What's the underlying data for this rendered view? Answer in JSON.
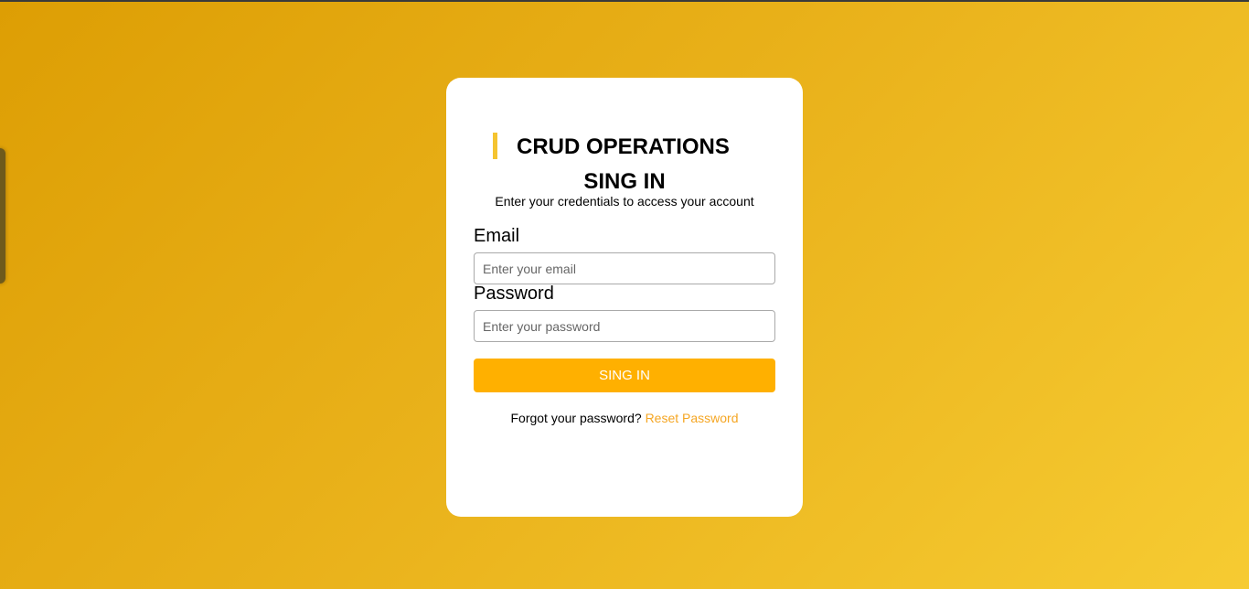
{
  "brand": "CRUD OPERATIONS",
  "title": "SING IN",
  "subtitle": "Enter your credentials to access your account",
  "email": {
    "label": "Email",
    "placeholder": "Enter your email",
    "value": ""
  },
  "password": {
    "label": "Password",
    "placeholder": "Enter your password",
    "value": ""
  },
  "submit": "SING IN",
  "forgot": {
    "text": "Forgot your password?",
    "link": "Reset Password"
  },
  "colors": {
    "accent": "#ffb000",
    "link": "#f5a623",
    "bar": "#f5c430"
  }
}
